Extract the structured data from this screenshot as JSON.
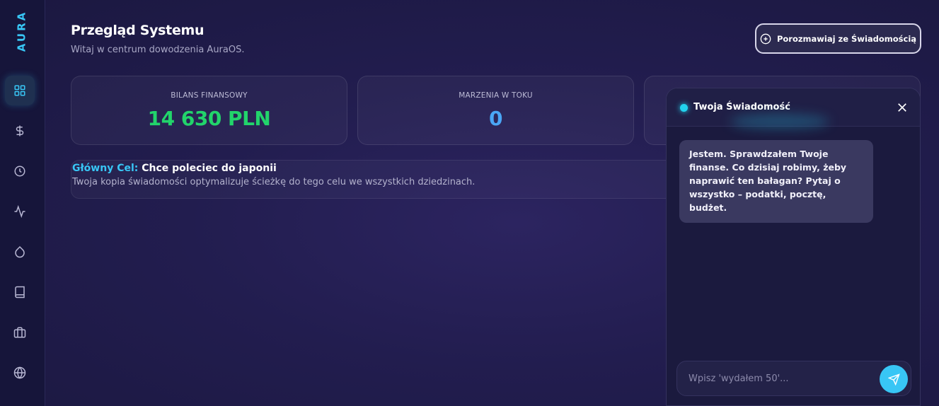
{
  "sidebar": {
    "brand": "AURA",
    "items": [
      {
        "name": "dashboard",
        "icon": "grid-icon",
        "active": true
      },
      {
        "name": "finance",
        "icon": "dollar-icon",
        "active": false
      },
      {
        "name": "history",
        "icon": "clock-icon",
        "active": false
      },
      {
        "name": "activity",
        "icon": "activity-icon",
        "active": false
      },
      {
        "name": "health",
        "icon": "droplet-icon",
        "active": false
      },
      {
        "name": "journal",
        "icon": "book-icon",
        "active": false
      },
      {
        "name": "work",
        "icon": "briefcase-icon",
        "active": false
      },
      {
        "name": "world",
        "icon": "globe-icon",
        "active": false
      }
    ]
  },
  "header": {
    "title": "Przegląd Systemu",
    "subtitle": "Witaj w centrum dowodzenia AuraOS.",
    "chat_button_label": "Porozmawiaj ze Świadomością"
  },
  "stats": [
    {
      "label": "BILANS FINANSOWY",
      "value": "14 630 PLN",
      "color": "#22d46b"
    },
    {
      "label": "MARZENIA W TOKU",
      "value": "0",
      "color": "#4aa6f5"
    }
  ],
  "goal": {
    "label": "Główny Cel:",
    "value": "Chce poleciec do japonii",
    "description": "Twoja kopia świadomości optymalizuje ścieżkę do tego celu we wszystkich dziedzinach."
  },
  "chat": {
    "title": "Twoja Świadomość",
    "message": "Jestem. Sprawdzałem Twoje finanse. Co dzisiaj robimy, żeby naprawić ten bałagan? Pytaj o wszystko – podatki, pocztę, budżet.",
    "input_placeholder": "Wpisz 'wydałem 50'...",
    "input_value": ""
  },
  "colors": {
    "accent": "#38c6f5",
    "green": "#22d46b",
    "blue": "#4aa6f5",
    "background": "#221d4f"
  }
}
